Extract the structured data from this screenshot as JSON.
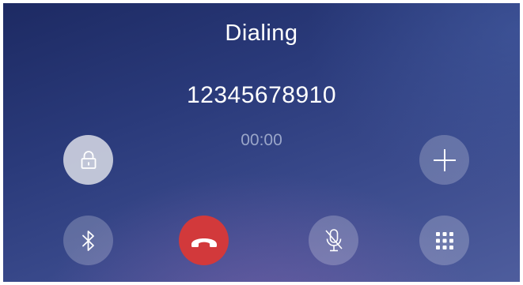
{
  "call": {
    "status": "Dialing",
    "number": "12345678910",
    "duration": "00:00"
  },
  "controls": {
    "lock": {
      "icon": "lock-icon"
    },
    "add_call": {
      "icon": "plus-icon"
    },
    "bluetooth": {
      "icon": "bluetooth-icon"
    },
    "end_call": {
      "icon": "phone-hangup-icon",
      "color": "#d2393b"
    },
    "mute": {
      "icon": "microphone-icon"
    },
    "keypad": {
      "icon": "keypad-grid-icon"
    }
  }
}
